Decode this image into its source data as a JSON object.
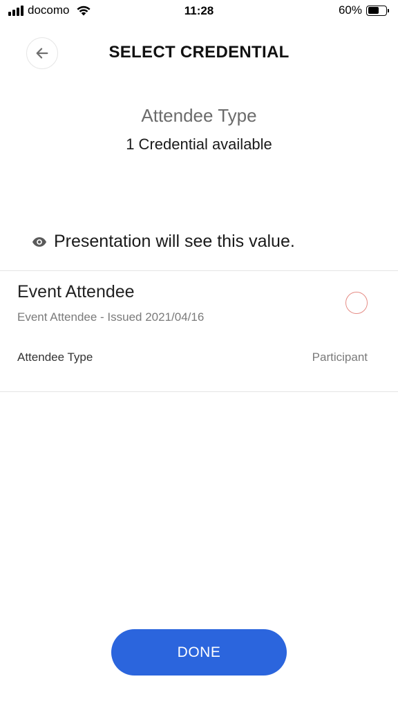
{
  "status_bar": {
    "carrier": "docomo",
    "time": "11:28",
    "battery": "60%",
    "battery_level": 0.6
  },
  "header": {
    "title": "SELECT CREDENTIAL",
    "back_icon": "arrow-left-icon"
  },
  "request": {
    "attribute_name": "Attendee Type",
    "available_text": "1 Credential available"
  },
  "notice": {
    "icon": "eye-icon",
    "text": "Presentation will see this value."
  },
  "credentials": [
    {
      "name": "Event Attendee",
      "subtitle": "Event Attendee - Issued 2021/04/16",
      "attribute_label": "Attendee Type",
      "attribute_value": "Participant",
      "selected": false
    }
  ],
  "actions": {
    "done_label": "DONE"
  },
  "colors": {
    "primary": "#2b65dd",
    "radio_border": "#e58b84",
    "divider": "#e4e4e4"
  }
}
